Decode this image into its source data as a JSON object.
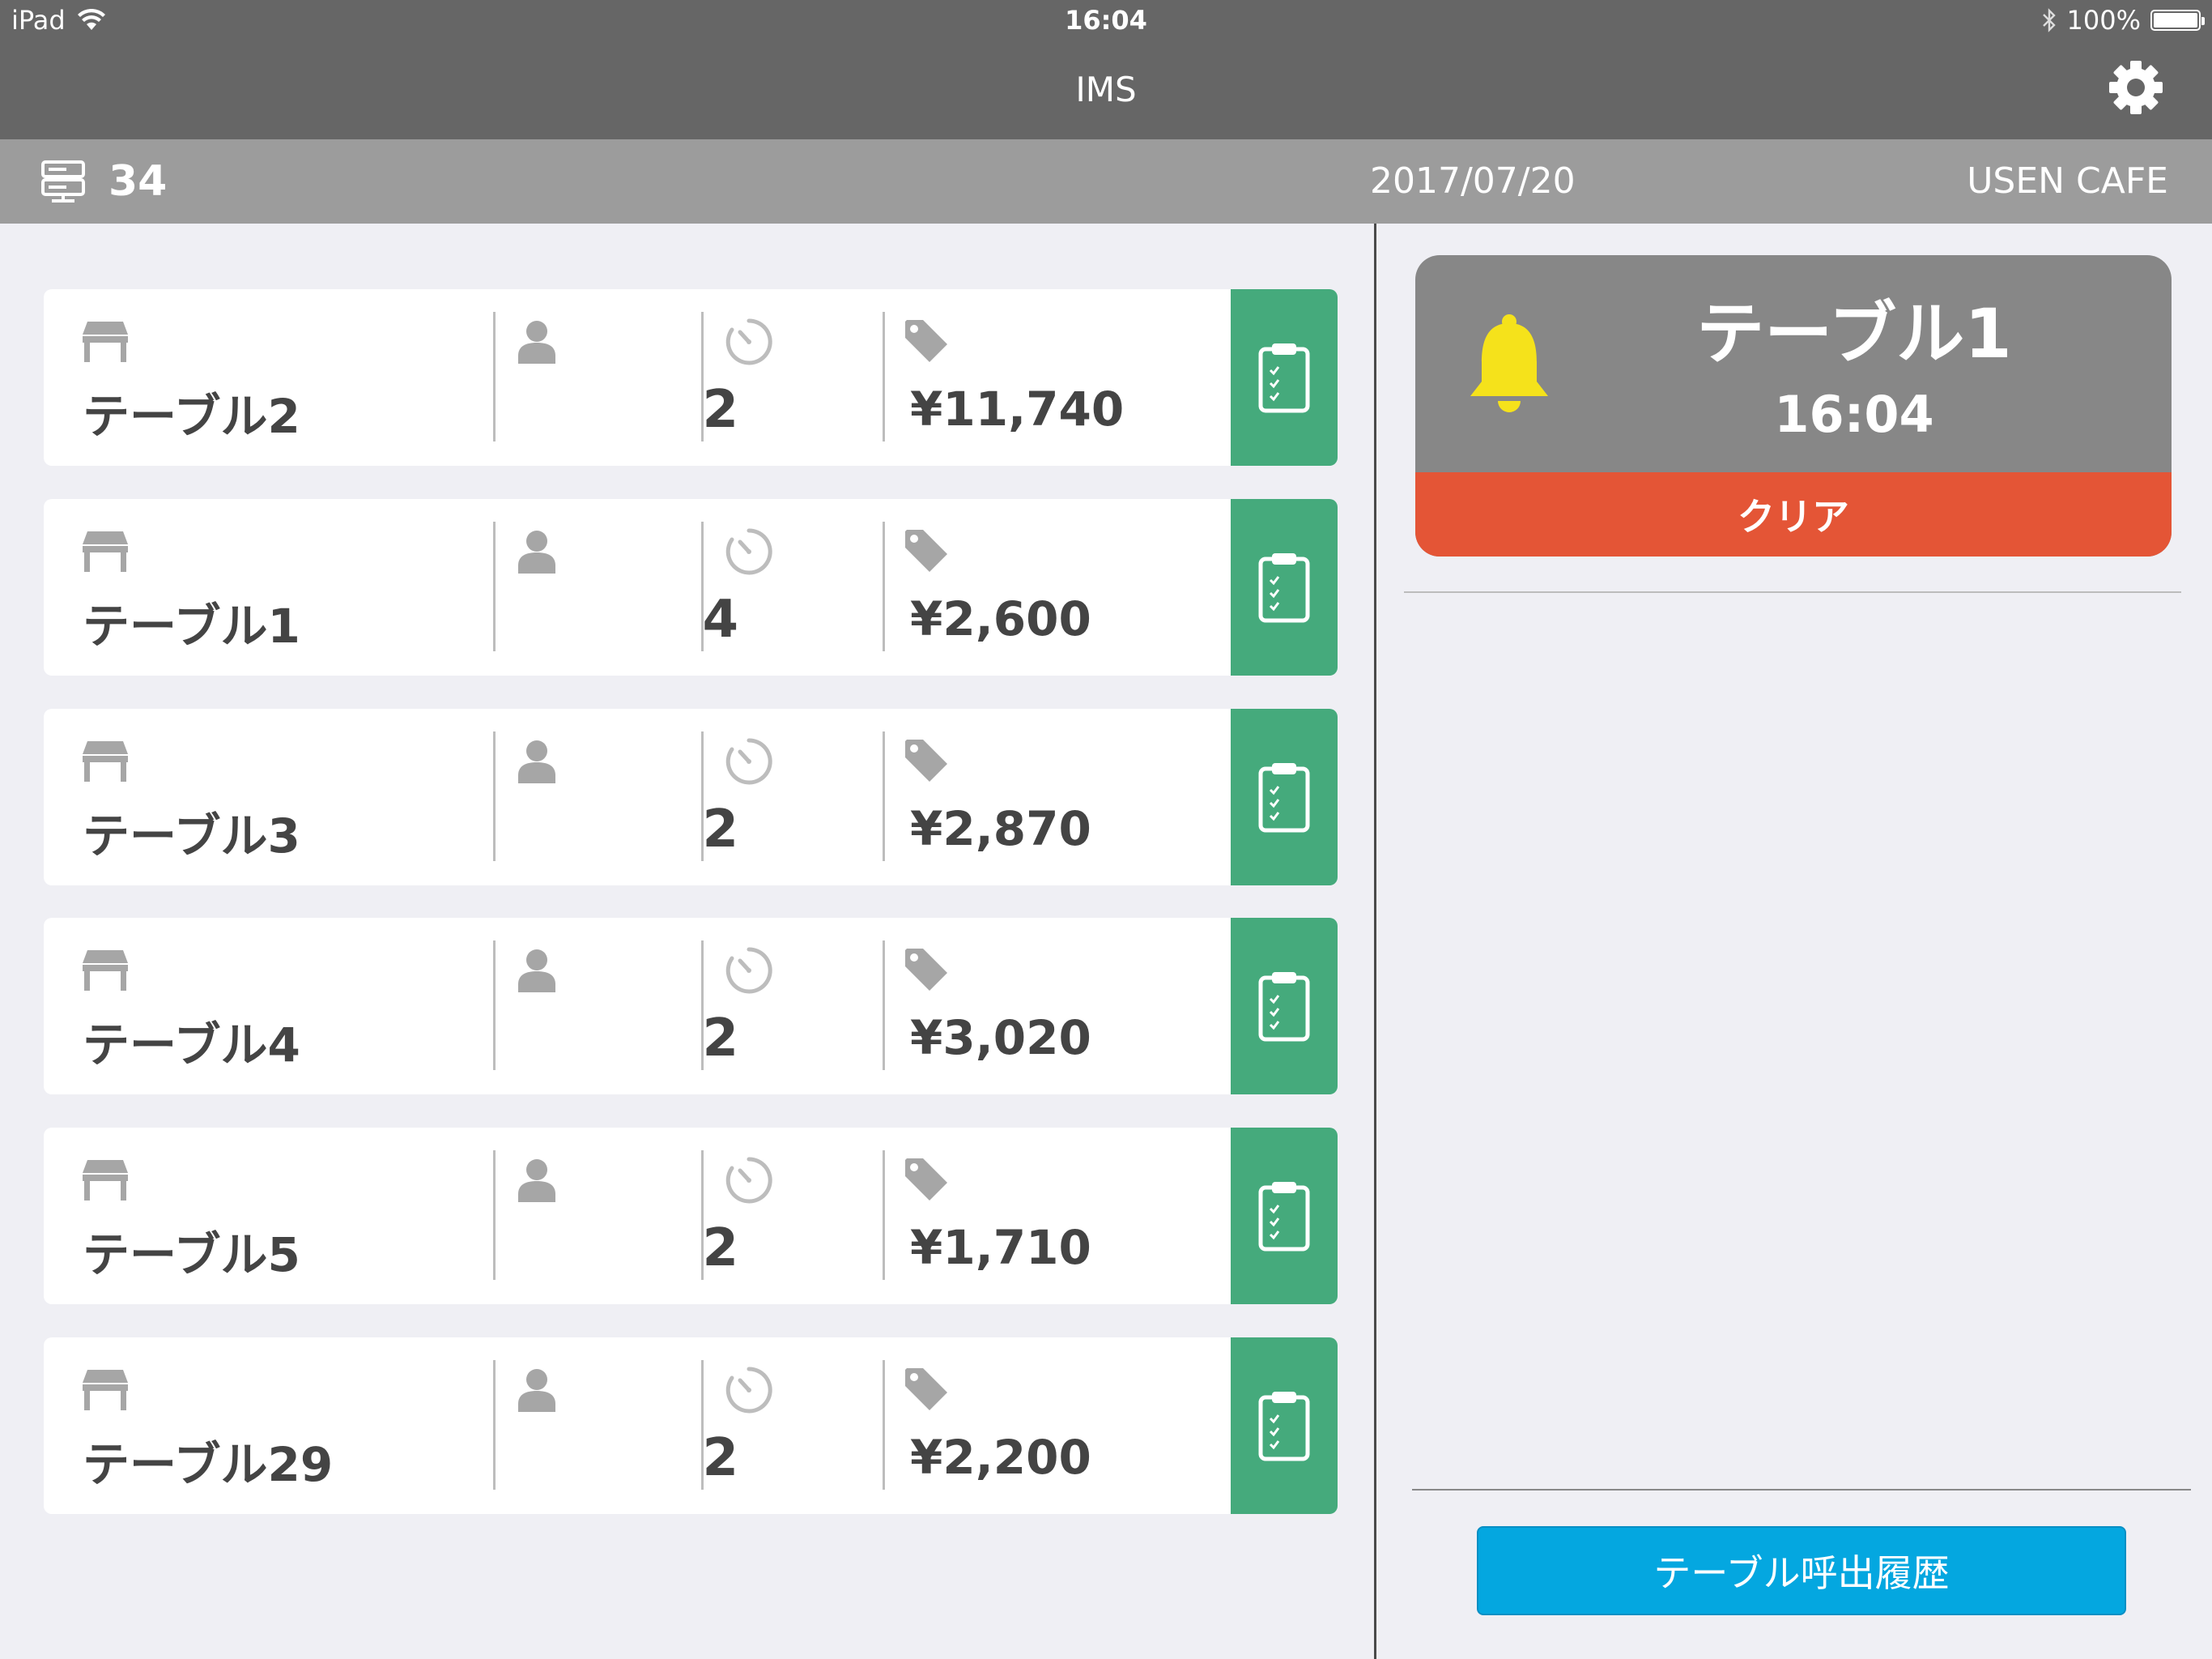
{
  "status_bar": {
    "device": "iPad",
    "time": "16:04",
    "battery": "100%",
    "battery_level": 1.0
  },
  "nav": {
    "title": "IMS",
    "settings_icon": "gear-icon"
  },
  "subheader": {
    "count": "34",
    "count_icon": "server-icon",
    "date": "2017/07/20",
    "shop": "USEN CAFE"
  },
  "tables": [
    {
      "name": "テーブル2",
      "guests": "2",
      "amount": "¥11,740"
    },
    {
      "name": "テーブル1",
      "guests": "4",
      "amount": "¥2,600"
    },
    {
      "name": "テーブル3",
      "guests": "2",
      "amount": "¥2,870"
    },
    {
      "name": "テーブル4",
      "guests": "2",
      "amount": "¥3,020"
    },
    {
      "name": "テーブル5",
      "guests": "2",
      "amount": "¥1,710"
    },
    {
      "name": "テーブル29",
      "guests": "2",
      "amount": "¥2,200"
    }
  ],
  "notification": {
    "title": "テーブル1",
    "time": "16:04",
    "clear_label": "クリア",
    "bell_color": "#f5e21b",
    "clear_color": "#e45536"
  },
  "history_button": {
    "label": "テーブル呼出履歴",
    "color": "#04a7e0"
  },
  "colors": {
    "order_button": "#45aa7c",
    "nav_bar": "#666666",
    "sub_bar": "#9c9c9c"
  }
}
